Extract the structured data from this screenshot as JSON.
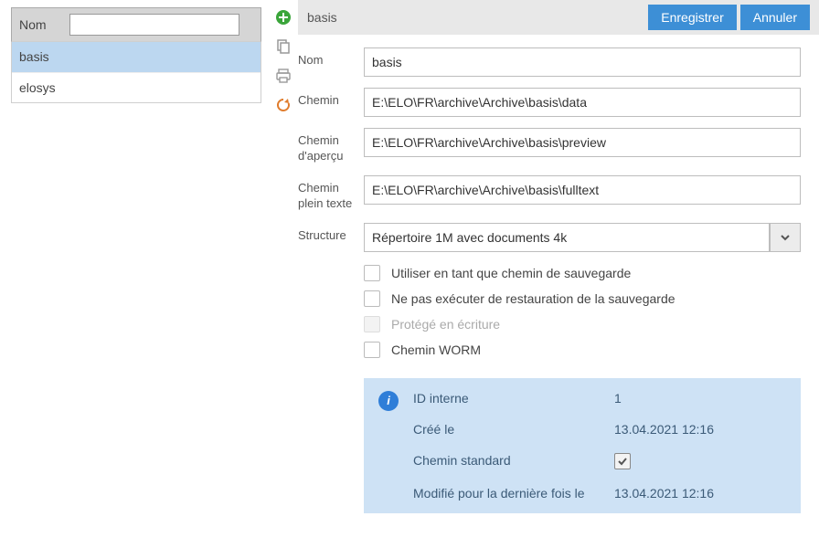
{
  "list": {
    "header_label": "Nom",
    "filter_value": "",
    "rows": [
      {
        "label": "basis",
        "selected": true
      },
      {
        "label": "elosys",
        "selected": false
      }
    ]
  },
  "toolbar": {
    "title": "basis",
    "save_label": "Enregistrer",
    "cancel_label": "Annuler"
  },
  "form": {
    "name_label": "Nom",
    "name_value": "basis",
    "path_label": "Chemin",
    "path_value": "E:\\ELO\\FR\\archive\\Archive\\basis\\data",
    "preview_label": "Chemin d'aperçu",
    "preview_value": "E:\\ELO\\FR\\archive\\Archive\\basis\\preview",
    "fulltext_label": "Chemin plein texte",
    "fulltext_value": "E:\\ELO\\FR\\archive\\Archive\\basis\\fulltext",
    "structure_label": "Structure",
    "structure_value": "Répertoire 1M avec documents 4k"
  },
  "checks": {
    "backup_path": "Utiliser en tant que chemin de sauvegarde",
    "no_restore": "Ne pas exécuter de restauration de la sauvegarde",
    "write_protected": "Protégé en écriture",
    "worm": "Chemin WORM"
  },
  "info": {
    "internal_id_label": "ID interne",
    "internal_id_value": "1",
    "created_label": "Créé le",
    "created_value": "13.04.2021 12:16",
    "standard_path_label": "Chemin standard",
    "standard_path_checked": true,
    "modified_label": "Modifié pour la dernière fois le",
    "modified_value": "13.04.2021 12:16"
  }
}
